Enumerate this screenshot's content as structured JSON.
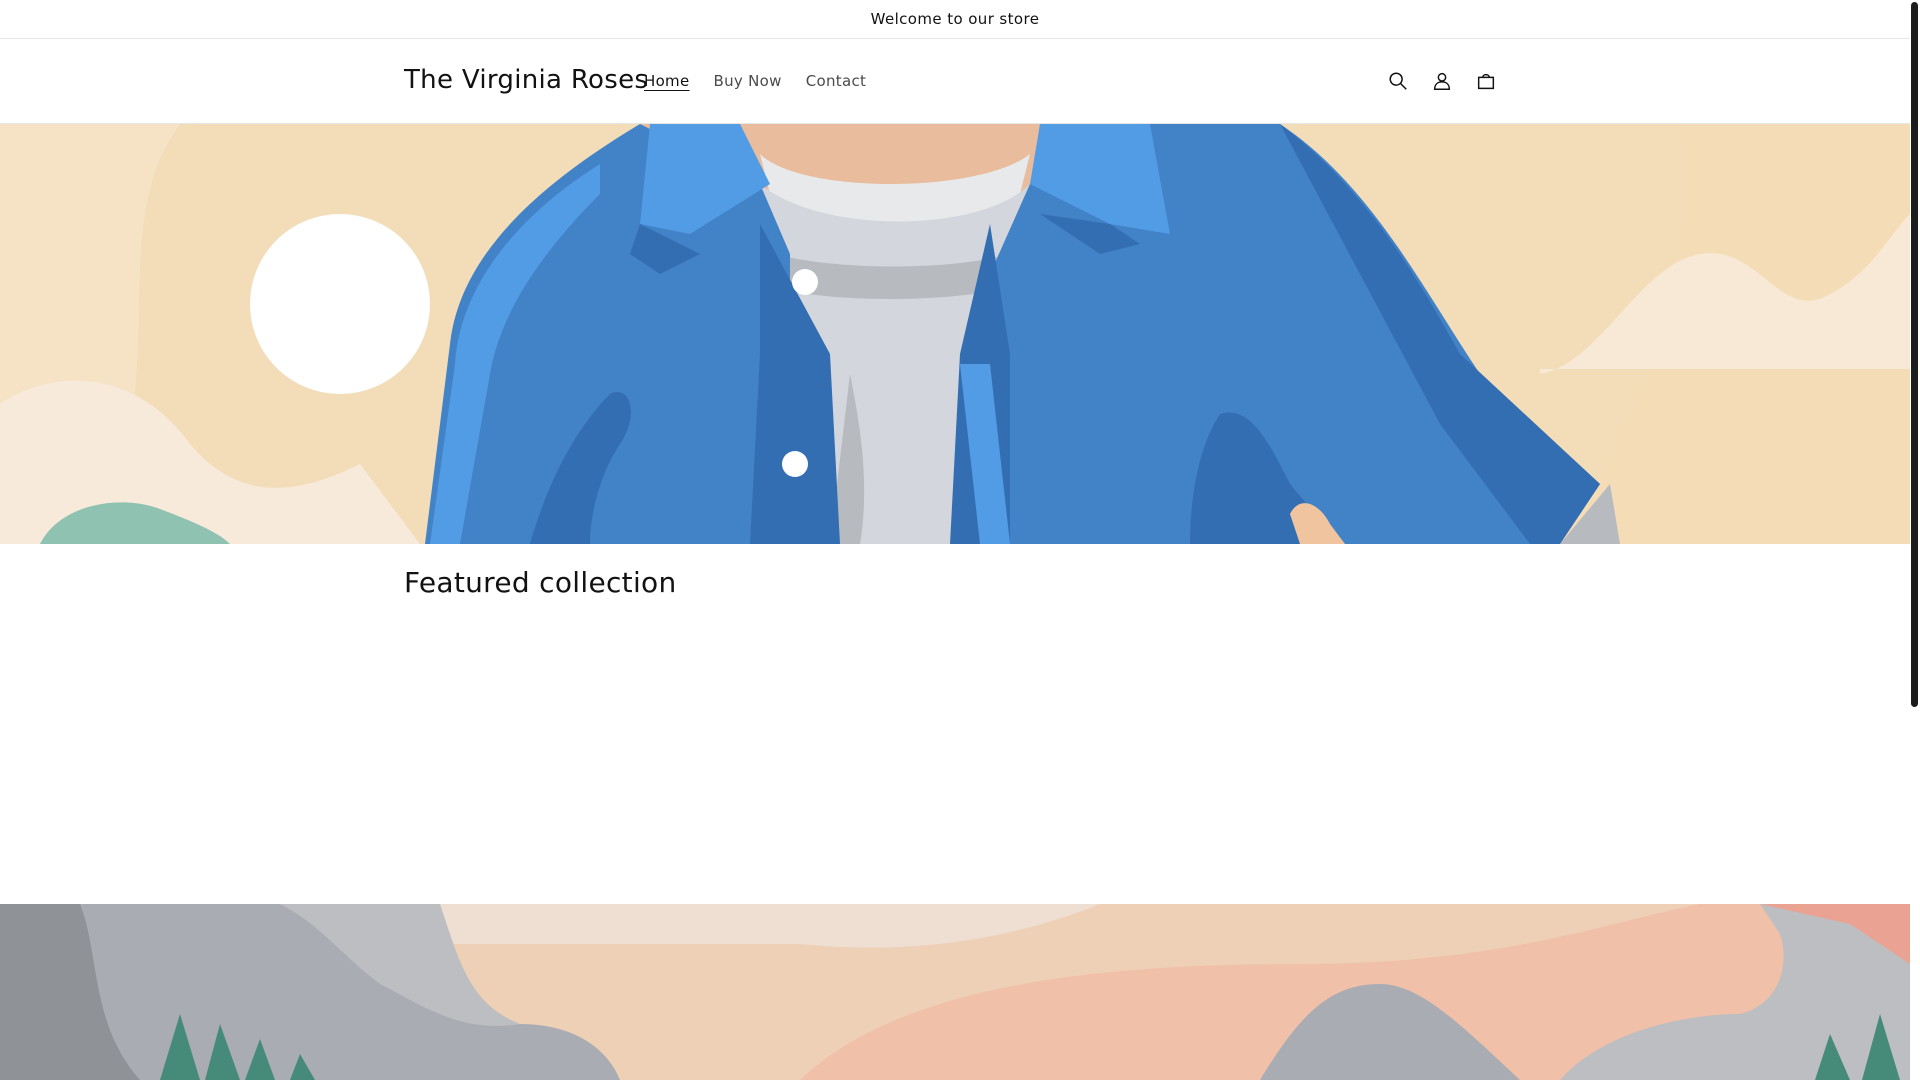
{
  "announcement": {
    "text": "Welcome to our store"
  },
  "header": {
    "logo": "The Virginia Roses",
    "nav": [
      {
        "label": "Home",
        "active": true
      },
      {
        "label": "Buy Now",
        "active": false
      },
      {
        "label": "Contact",
        "active": false
      }
    ],
    "icons": [
      "search-icon",
      "account-icon",
      "cart-icon"
    ]
  },
  "hero": {
    "illustration": "person-in-blue-jacket"
  },
  "featured": {
    "title": "Featured collection"
  },
  "colors": {
    "hero_bg": "#f3ddb9",
    "jacket": "#4282c6",
    "jacket_dark": "#336eb3",
    "jacket_light": "#529ce6",
    "shirt": "#d3d6dc",
    "skin": "#e8bc9c",
    "footer_sand": "#edd2b8",
    "footer_rock": "#a9acb2",
    "tree": "#468a7a"
  }
}
